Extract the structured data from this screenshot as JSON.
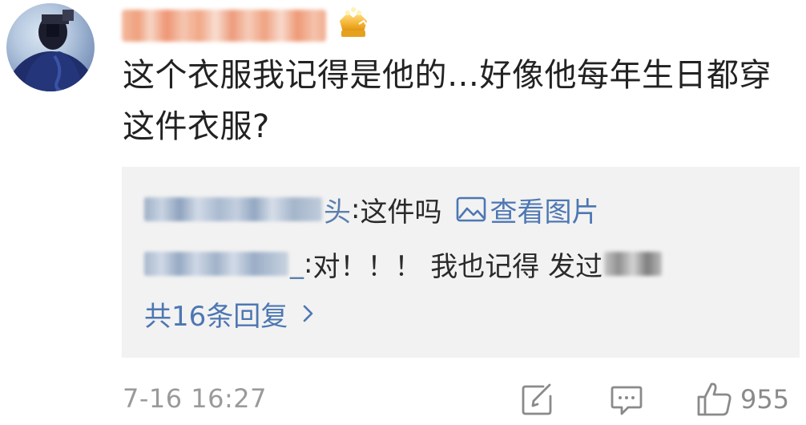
{
  "comment": {
    "text": "这个衣服我记得是他的…好像他每年生日都穿这件衣服?",
    "timestamp": "7-16 16:27",
    "like_count": "955"
  },
  "replies": [
    {
      "name_suffix": "头",
      "separator": ": ",
      "text": "这件吗",
      "image_link_label": "查看图片"
    },
    {
      "name_suffix": "_",
      "separator": ": ",
      "text": "对！！！ 我也记得 发过"
    }
  ],
  "total_replies_label": "共16条回复",
  "icons": {
    "image": "image-icon",
    "chevron": "chevron-right-icon",
    "share": "share-icon",
    "comment": "comment-icon",
    "like": "thumbs-up-icon",
    "badge": "gold-badge-icon"
  },
  "colors": {
    "link": "#4d77b3",
    "reply_box_bg": "#f2f2f2",
    "timestamp": "#9a9a9a",
    "action_icon": "#8a8a8a"
  }
}
